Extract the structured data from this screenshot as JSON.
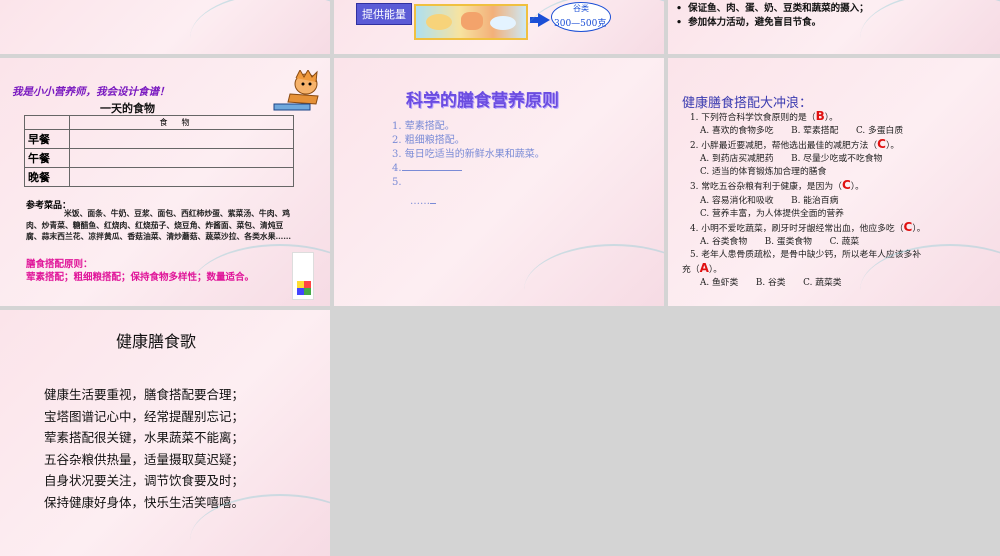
{
  "slide2": {
    "tag": "提供能量",
    "grain_label": "谷类",
    "grain_amount": "300—500克"
  },
  "slide3": {
    "bullets": [
      "保证鱼、肉、蛋、奶、豆类和蔬菜的摄入；",
      "参加体力活动，避免盲目节食。"
    ]
  },
  "slide4": {
    "heading": "我是小小营养师，我会设计食谱！",
    "subheading": "一天的食物",
    "table_header": "食物",
    "meals": [
      "早餐",
      "午餐",
      "晚餐"
    ],
    "ref_title": "参考菜品：",
    "ref_body": "米饭、面条、牛奶、豆浆、面包、西红柿炒蛋、紫菜汤、牛肉、鸡肉、炒青菜、糖醋鱼、红烧肉、红烧茄子、烧豆角、炸酱面、菜包、清炖豆腐、蒜末西兰花、凉拌黄瓜、香菇油菜、清炒蘑菇、蔬菜沙拉、各类水果……",
    "principle_title": "膳食搭配原则：",
    "principle_body": "荤素搭配；粗细粮搭配；保持食物多样性；数量适合。"
  },
  "slide5": {
    "title": "科学的膳食营养原则",
    "items": [
      "1. 荤素搭配。",
      "2. 粗细粮搭配。",
      "3. 每日吃适当的新鲜水果和蔬菜。",
      "4.",
      "5."
    ],
    "ellipsis": "……"
  },
  "slide6": {
    "title": "健康膳食搭配大冲浪：",
    "q1": "1. 下列符合科学饮食原则的是（",
    "q1_ans": "B",
    "q1_end": "）。",
    "q1_opts": "A. 喜欢的食物多吃　　B. 荤素搭配　　C. 多蛋白质",
    "q2": "2. 小胖最近要减肥，帮他选出最佳的减肥方法（",
    "q2_ans": "C",
    "q2_end": "）。",
    "q2_opts_a": "A. 到药店买减肥药　　B. 尽量少吃或不吃食物",
    "q2_opts_b": "C. 适当的体育锻炼加合理的膳食",
    "q3": "3. 常吃五谷杂粮有利于健康，是因为（",
    "q3_ans": "C",
    "q3_end": "）。",
    "q3_opts_a": "A. 容易消化和吸收　　B. 能治百病",
    "q3_opts_b": "C. 营养丰富，为人体提供全面的营养",
    "q4": "4. 小明不爱吃蔬菜，刷牙时牙龈经常出血，他应多吃（",
    "q4_ans": "C",
    "q4_end": "）。",
    "q4_opts": "A. 谷类食物　　B. 蛋类食物　　C. 蔬菜",
    "q5": "5. 老年人患骨质疏松，是骨中缺少钙，所以老年人应该多补",
    "q5_b": "充（",
    "q5_ans": "A",
    "q5_end": "）。",
    "q5_opts": "A. 鱼虾类　　B. 谷类　　C. 蔬菜类"
  },
  "slide7": {
    "title": "健康膳食歌",
    "lines": [
      "健康生活要重视，膳食搭配要合理；",
      "宝塔图谱记心中，经常提醒别忘记；",
      "荤素搭配很关键，水果蔬菜不能离；",
      "五谷杂粮供热量，适量摄取莫迟疑；",
      "自身状况要关注，调节饮食要及时；",
      "保持健康好身体，快乐生活笑嘻嘻。"
    ]
  }
}
